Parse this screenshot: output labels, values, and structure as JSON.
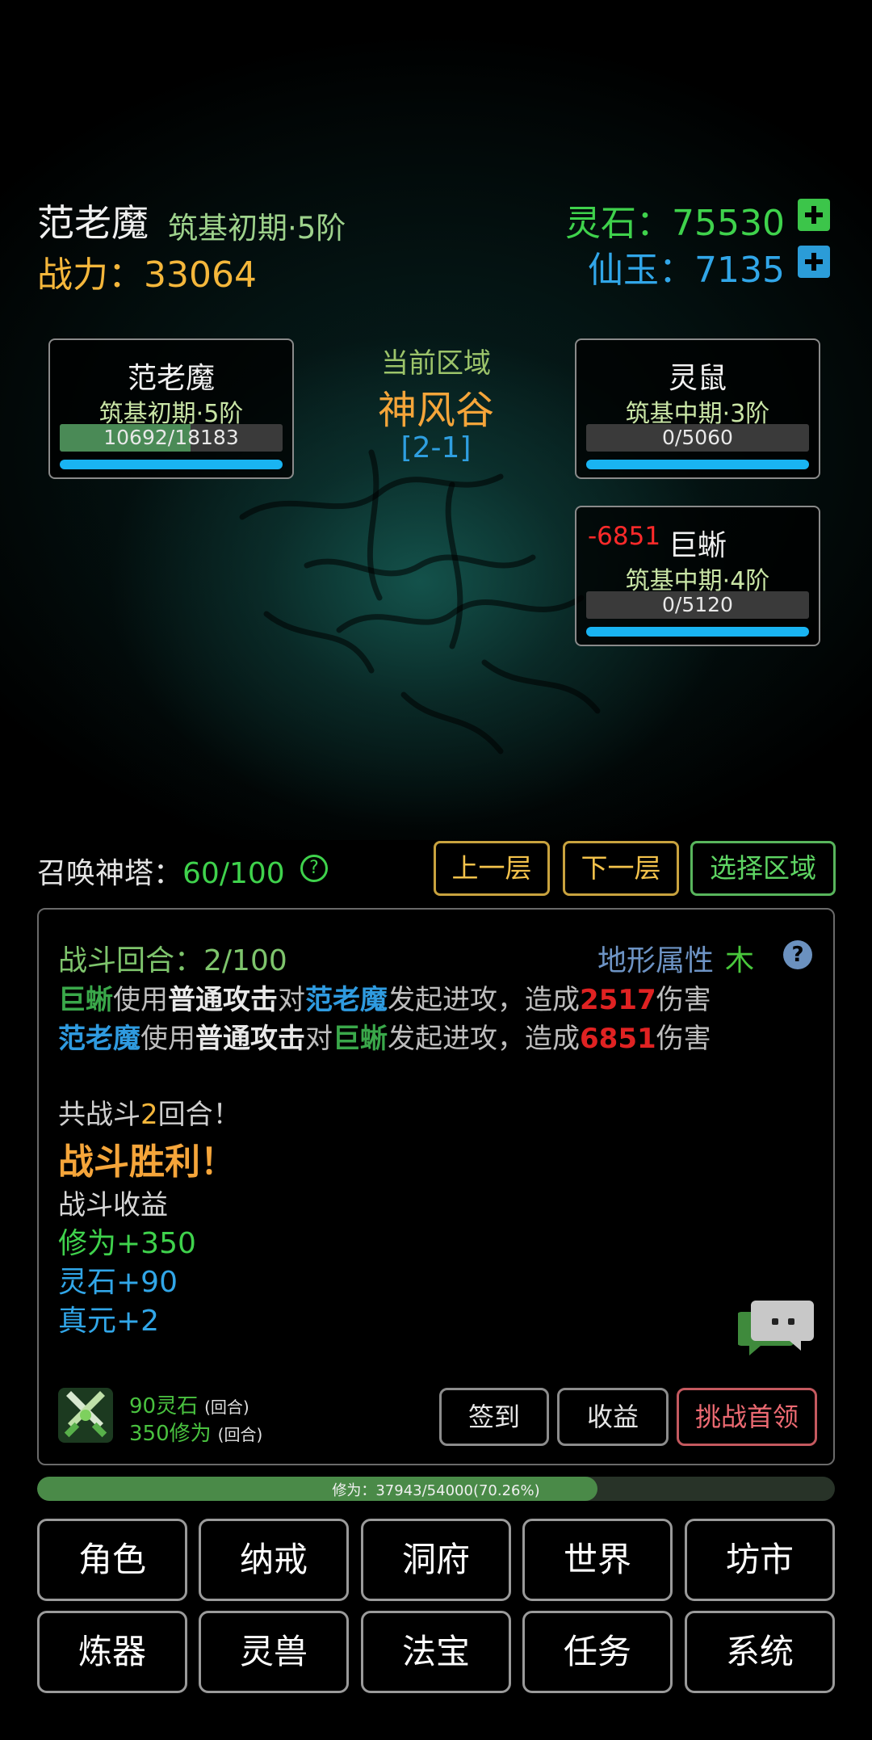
{
  "header": {
    "player_name": "范老魔",
    "player_realm": "筑基初期·5阶",
    "power_label": "战力：",
    "power_value": "33064",
    "spirit_stone_label": "灵石：",
    "spirit_stone_value": "75530",
    "jade_label": "仙玉：",
    "jade_value": "7135",
    "plus_icon": "plus-icon"
  },
  "player_card": {
    "name": "范老魔",
    "realm": "筑基初期·5阶",
    "hp_text": "10692/18183",
    "hp_fraction": 0.588
  },
  "zone": {
    "label": "当前区域",
    "name": "神风谷",
    "code": "[2-1]"
  },
  "enemies": [
    {
      "name": "灵鼠",
      "realm": "筑基中期·3阶",
      "hp_text": "0/5060",
      "hp_fraction": 0,
      "damage": ""
    },
    {
      "name": "巨蜥",
      "realm": "筑基中期·4阶",
      "hp_text": "0/5120",
      "hp_fraction": 0,
      "damage": "-6851"
    }
  ],
  "tower": {
    "label": "召唤神塔：",
    "value": "60/100",
    "help": "?",
    "prev_floor": "上一层",
    "next_floor": "下一层",
    "select_zone": "选择区域"
  },
  "battle": {
    "round_text": "战斗回合：2/100",
    "terrain_label": "地形属性",
    "terrain_value": "木",
    "terrain_help": "?",
    "log": [
      {
        "actor": "巨蜥",
        "uses": "使用",
        "skill": "普通攻击",
        "to": "对",
        "target": "范老魔",
        "act": "发起进攻，造成",
        "damage": "2517",
        "suffix": "伤害"
      },
      {
        "actor": "范老魔",
        "uses": "使用",
        "skill": "普通攻击",
        "to": "对",
        "target": "巨蜥",
        "act": "发起进攻，造成",
        "damage": "6851",
        "suffix": "伤害"
      }
    ],
    "summary_pre": "共战斗",
    "summary_num": "2",
    "summary_post": "回合！",
    "victory": "战斗胜利！",
    "rewards_title": "战斗收益",
    "rewards": [
      "修为+350",
      "灵石+90",
      "真元+2"
    ],
    "rate_stone": "90灵石",
    "rate_cult": "350修为",
    "rate_unit": "(回合)",
    "btn_sign": "签到",
    "btn_income": "收益",
    "btn_boss": "挑战首领"
  },
  "cultivation": {
    "text": "修为：37943/54000(70.26%)",
    "fraction": 0.7026
  },
  "menu": [
    "角色",
    "纳戒",
    "洞府",
    "世界",
    "坊市",
    "炼器",
    "灵兽",
    "法宝",
    "任务",
    "系统"
  ],
  "colors": {
    "green": "#3fd24c",
    "blue": "#31a6e8",
    "gold": "#f5b73b",
    "red": "#e02222"
  }
}
